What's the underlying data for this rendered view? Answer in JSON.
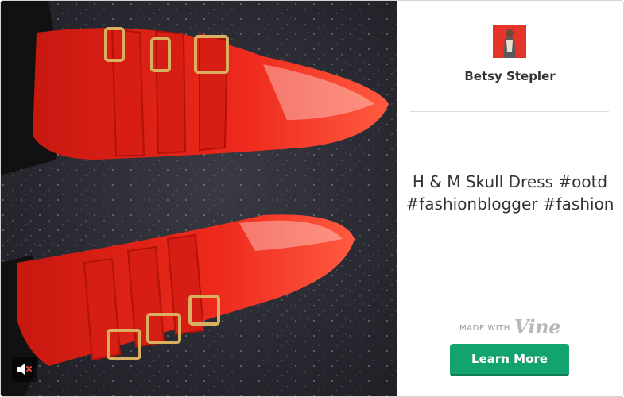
{
  "author": {
    "name": "Betsy Stepler"
  },
  "post": {
    "caption": "H & M Skull Dress #ootd #fashionblogger #fashion"
  },
  "branding": {
    "made_with": "MADE WITH",
    "logo": "Vine"
  },
  "cta": {
    "label": "Learn More"
  },
  "video": {
    "muted": true,
    "mute_icon": "speaker-muted-icon"
  },
  "colors": {
    "cta": "#13a36f",
    "cta_shadow": "#0c7d54",
    "boot": "#e8231a",
    "avatar_bg": "#e5352b",
    "floor": "#2a2a33",
    "mute_x": "#e0483e"
  }
}
